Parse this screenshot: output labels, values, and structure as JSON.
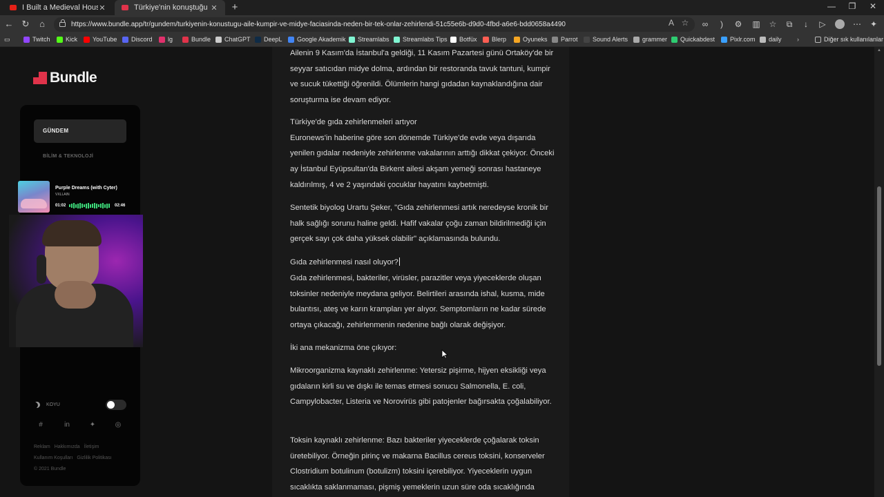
{
  "browser": {
    "tabs": [
      {
        "title": "I Built a Medieval House Using Pr",
        "favicon": "youtube-icon"
      },
      {
        "title": "Türkiye'nin konuştuğu aile: Kump",
        "favicon": "bundle-icon"
      }
    ],
    "url": "https://www.bundle.app/tr/gundem/turkiyenin-konustugu-aile-kumpir-ve-midye-faciasinda-neden-bir-tek-onlar-zehirlendi-51c55e6b-d9d0-4fbd-a6e6-bdd0658a4490",
    "bookmarks": [
      {
        "label": "Twitch",
        "color": "#9146ff"
      },
      {
        "label": "Kick",
        "color": "#53fc18"
      },
      {
        "label": "YouTube",
        "color": "#ff0000"
      },
      {
        "label": "Discord",
        "color": "#5865f2"
      },
      {
        "label": "lg",
        "color": "#e1306c"
      },
      {
        "label": "Bundle",
        "color": "#e0334a"
      },
      {
        "label": "ChatGPT",
        "color": "#cccccc"
      },
      {
        "label": "DeepL",
        "color": "#0f2b46"
      },
      {
        "label": "Google Akademik",
        "color": "#4285f4"
      },
      {
        "label": "Streamlabs",
        "color": "#80f5d2"
      },
      {
        "label": "Streamlabs Tips",
        "color": "#80f5d2"
      },
      {
        "label": "Botfüx",
        "color": "#ffffff"
      },
      {
        "label": "Blerp",
        "color": "#fe5e53"
      },
      {
        "label": "Oyuneks",
        "color": "#f5a623"
      },
      {
        "label": "Parrot",
        "color": "#888888"
      },
      {
        "label": "Sound Alerts",
        "color": "#444444"
      },
      {
        "label": "grammer",
        "color": "#aaaaaa"
      },
      {
        "label": "Quickabdest",
        "color": "#2ecc71"
      },
      {
        "label": "Pixlr.com",
        "color": "#3aa0ff"
      },
      {
        "label": "daily",
        "color": "#bbbbbb"
      }
    ],
    "other_bookmarks": "Diğer sık kullanılanlar"
  },
  "site": {
    "logo": "Bundle",
    "nav_active": "GÜNDEM",
    "nav_item": "BİLİM & TEKNOLOJİ",
    "theme_label": "KOYU",
    "footer_links": [
      "Reklam",
      "Hakkımızda",
      "İletişim",
      "Kullanım Koşulları",
      "Gizlilik Politikası"
    ],
    "copyright": "© 2021 Bundle"
  },
  "player": {
    "song": "Purple Dreams (with Cyter)",
    "artist": "VXLLAIN",
    "time_elapsed": "01:02",
    "time_total": "02:46"
  },
  "article": {
    "paragraphs": [
      "Ailenin 9 Kasım'da İstanbul'a geldiği, 11 Kasım Pazartesi günü Ortaköy'de bir seyyar satıcıdan midye dolma, ardından bir restoranda tavuk tantuni, kumpir ve sucuk tükettiği öğrenildi. Ölümlerin hangi gıdadan kaynaklandığına dair soruşturma ise devam ediyor.",
      "Türkiye'de gıda zehirlenmeleri artıyor\nEuronews'in haberine göre son dönemde Türkiye'de evde veya dışarıda yenilen gıdalar nedeniyle zehirlenme vakalarının arttığı dikkat çekiyor. Önceki ay İstanbul Eyüpsultan'da Birkent ailesi akşam yemeği sonrası hastaneye kaldırılmış, 4 ve 2 yaşındaki çocuklar hayatını kaybetmişti.",
      "Sentetik biyolog Urartu Şeker, \"Gıda zehirlenmesi artık neredeyse kronik bir halk sağlığı sorunu haline geldi. Hafif vakalar çoğu zaman bildirilmediği için gerçek sayı çok daha yüksek olabilir\" açıklamasında bulundu.",
      "Gıda zehirlenmesi nasıl oluyor?",
      "Gıda zehirlenmesi, bakteriler, virüsler, parazitler veya yiyeceklerde oluşan toksinler nedeniyle meydana geliyor. Belirtileri arasında ishal, kusma, mide bulantısı, ateş ve karın krampları yer alıyor. Semptomların ne kadar sürede ortaya çıkacağı, zehirlenmenin nedenine bağlı olarak değişiyor.",
      "İki ana mekanizma öne çıkıyor:",
      "Mikroorganizma kaynaklı zehirlenme: Yetersiz pişirme, hijyen eksikliği veya gıdaların kirli su ve dışkı ile temas etmesi sonucu Salmonella, E. coli, Campylobacter, Listeria ve Norovirüs gibi patojenler bağırsakta çoğalabiliyor.",
      "Toksin kaynaklı zehirlenme: Bazı bakteriler yiyeceklerde çoğalarak toksin üretebiliyor. Örneğin pirinç ve makarna Bacillus cereus toksini, konserveler Clostridium botulinum (botulizm) toksini içerebiliyor. Yiyeceklerin uygun sıcaklıkta saklanmaması, pişmiş yemeklerin uzun süre oda sıcaklığında"
    ]
  }
}
